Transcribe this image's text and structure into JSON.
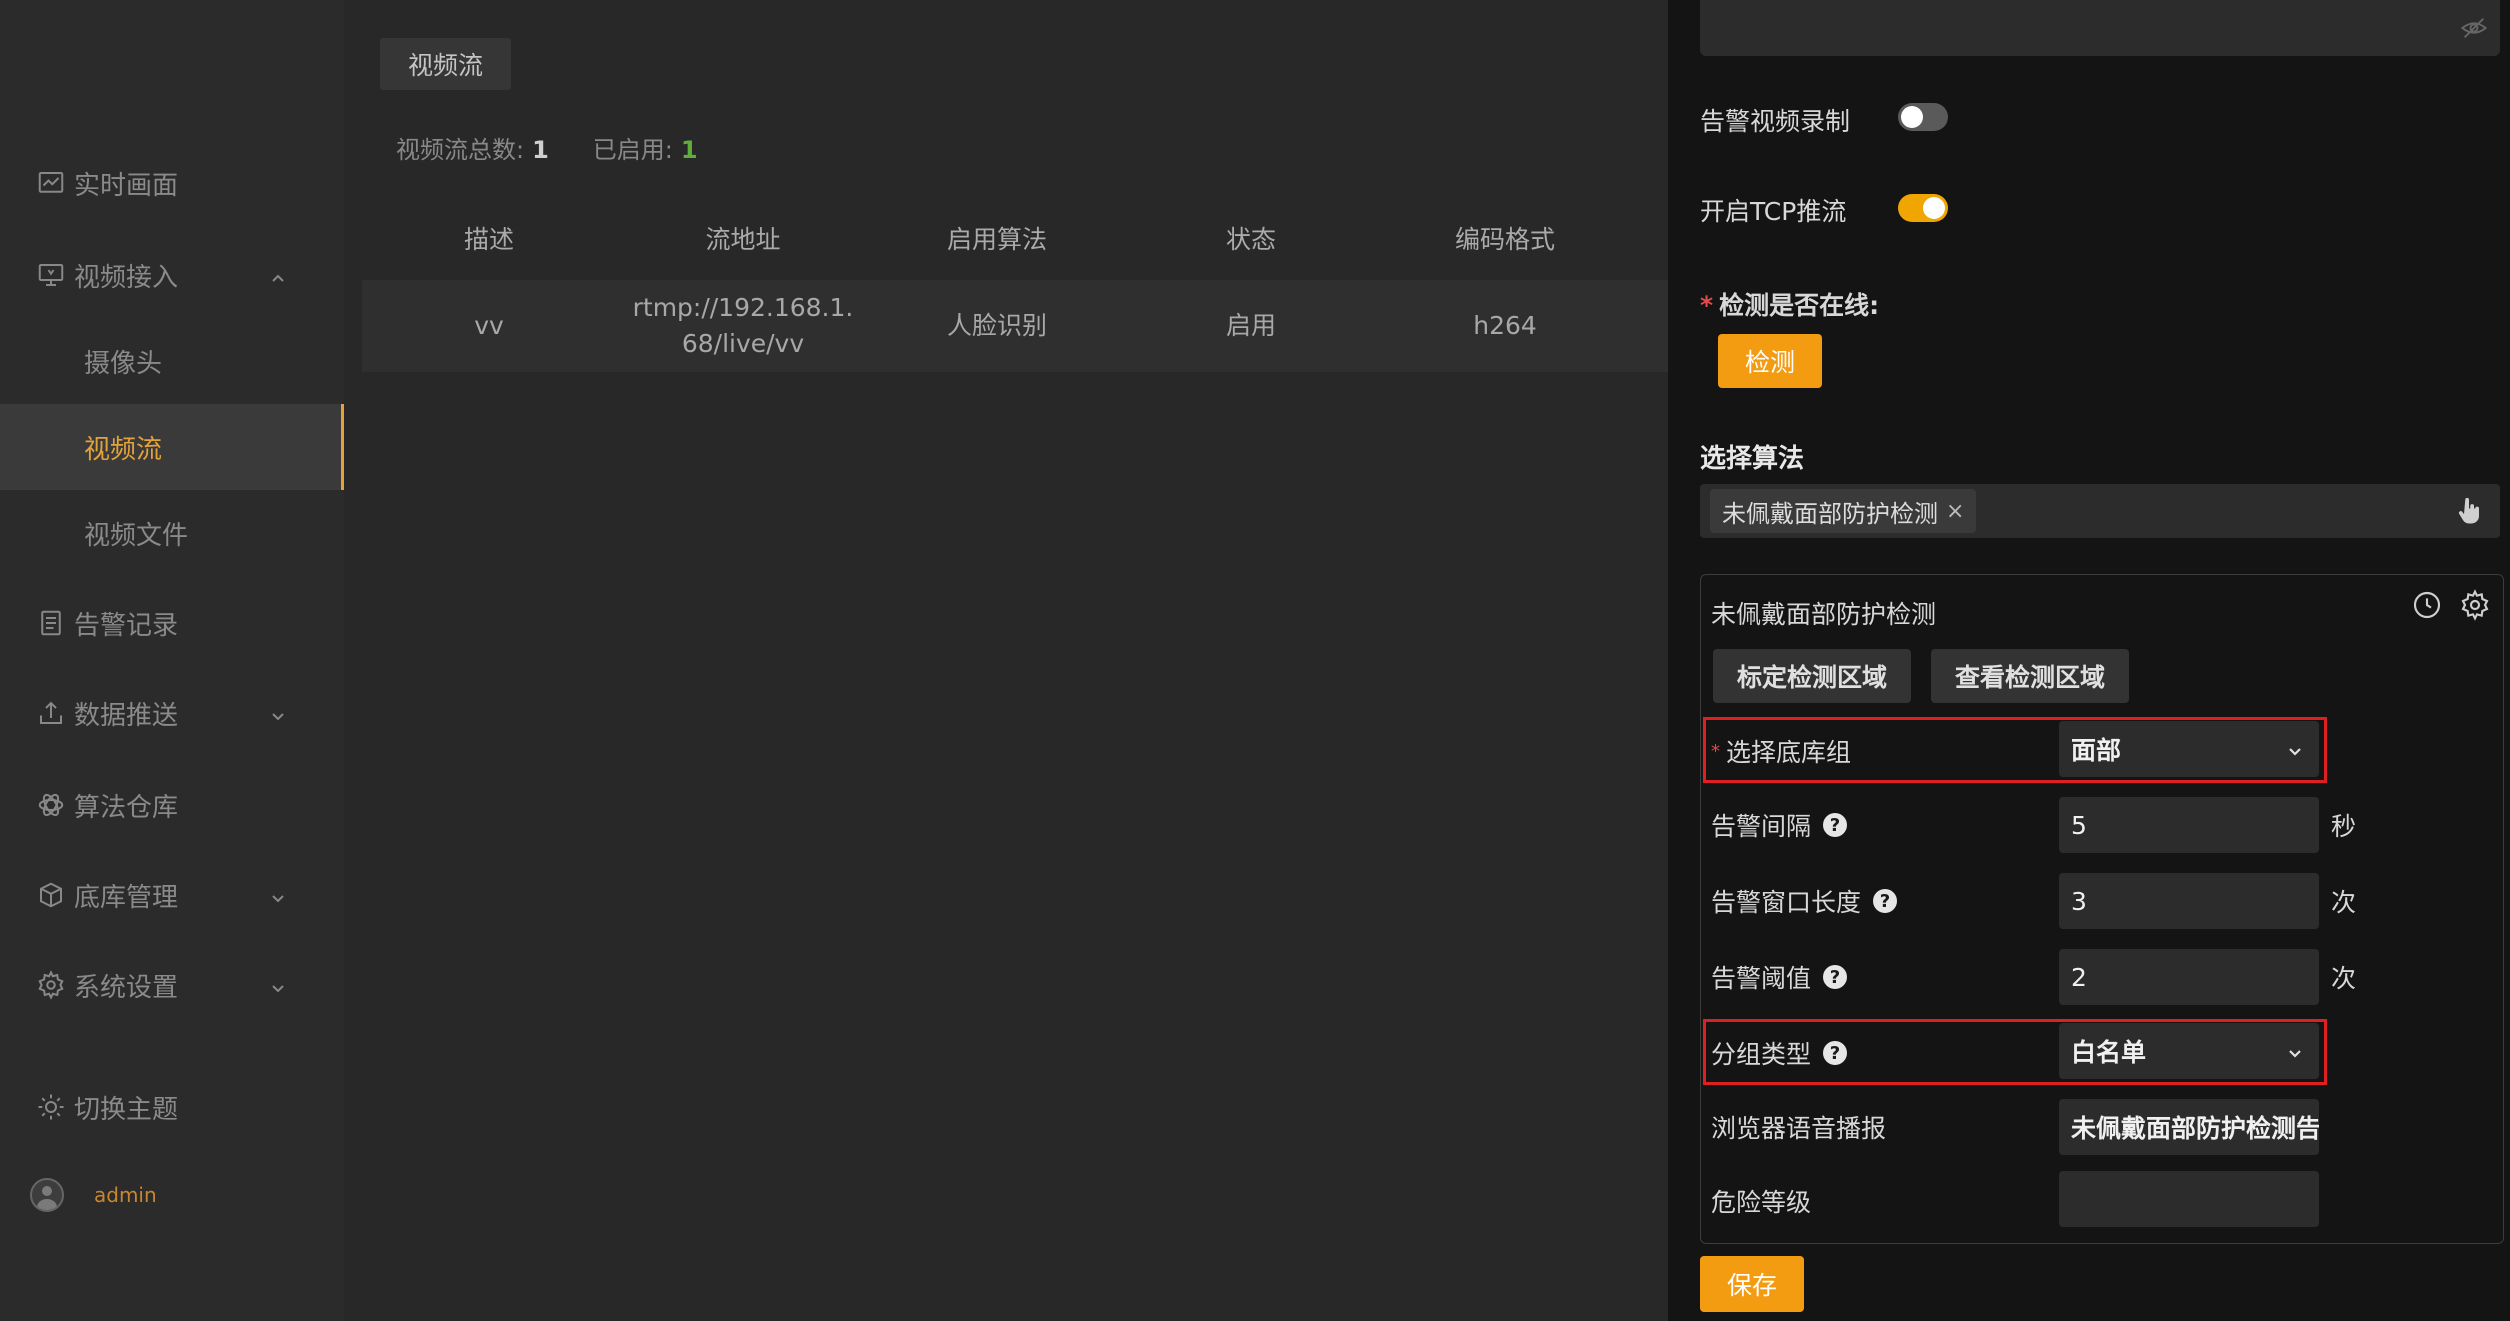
{
  "sidebar": {
    "items": [
      {
        "label": "实时画面",
        "icon": "chart-icon"
      },
      {
        "label": "视频接入",
        "icon": "monitor-icon",
        "expanded": true
      },
      {
        "label": "告警记录",
        "icon": "list-icon"
      },
      {
        "label": "数据推送",
        "icon": "upload-icon"
      },
      {
        "label": "算法仓库",
        "icon": "atom-icon"
      },
      {
        "label": "底库管理",
        "icon": "cube-icon"
      },
      {
        "label": "系统设置",
        "icon": "gear-icon"
      }
    ],
    "sub_items": [
      {
        "label": "摄像头"
      },
      {
        "label": "视频流",
        "active": true
      },
      {
        "label": "视频文件"
      }
    ],
    "theme_label": "切换主题",
    "user_name": "admin"
  },
  "main": {
    "tab_label": "视频流",
    "stats": {
      "total_label": "视频流总数:",
      "total_value": "1",
      "enabled_label": "已启用:",
      "enabled_value": "1"
    },
    "table": {
      "columns": [
        "描述",
        "流地址",
        "启用算法",
        "状态",
        "编码格式"
      ],
      "rows": [
        {
          "desc": "vv",
          "url_line1": "rtmp://192.168.1.",
          "url_line2": "68/live/vv",
          "algorithm": "人脸识别",
          "status": "启用",
          "codec": "h264"
        }
      ]
    }
  },
  "panel": {
    "alarm_record_label": "告警视频录制",
    "alarm_record_on": false,
    "tcp_push_label": "开启TCP推流",
    "tcp_push_on": true,
    "online_check_label": "检测是否在线:",
    "check_button": "检测",
    "select_algo_title": "选择算法",
    "selected_algo_tag": "未佩戴面部防护检测",
    "card": {
      "title": "未佩戴面部防护检测",
      "btn_mark_area": "标定检测区域",
      "btn_view_area": "查看检测区域",
      "fields": {
        "library_group": {
          "label": "选择底库组",
          "value": "面部"
        },
        "alarm_interval": {
          "label": "告警间隔",
          "value": "5",
          "unit": "秒"
        },
        "window_length": {
          "label": "告警窗口长度",
          "value": "3",
          "unit": "次"
        },
        "threshold": {
          "label": "告警阈值",
          "value": "2",
          "unit": "次"
        },
        "group_type": {
          "label": "分组类型",
          "value": "白名单"
        },
        "voice": {
          "label": "浏览器语音播报",
          "value": "未佩戴面部防护检测告"
        },
        "danger_level": {
          "label": "危险等级",
          "value": ""
        }
      }
    },
    "save_button": "保存"
  },
  "colors": {
    "accent": "#f39c12",
    "active_text": "#e3a33c",
    "highlight_border": "#e02020",
    "enabled_count": "#5fae3c"
  }
}
